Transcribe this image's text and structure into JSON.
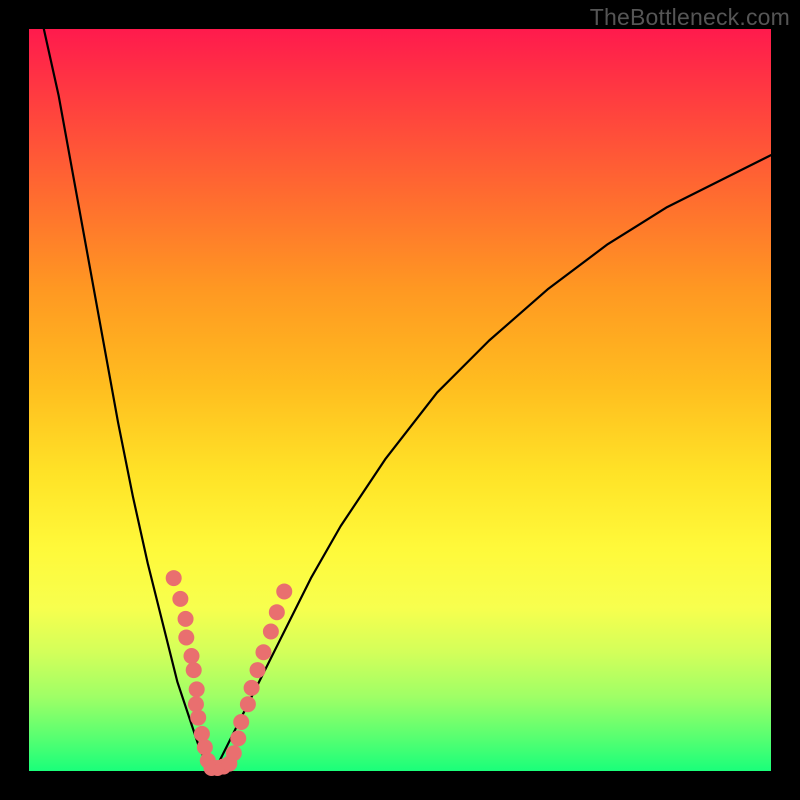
{
  "watermark": "TheBottleneck.com",
  "chart_data": {
    "type": "line",
    "title": "",
    "xlabel": "",
    "ylabel": "",
    "xlim": [
      0,
      100
    ],
    "ylim": [
      0,
      100
    ],
    "grid": false,
    "legend": false,
    "series": [
      {
        "name": "left-curve",
        "x": [
          2,
          4,
          6,
          8,
          10,
          12,
          14,
          16,
          18,
          20,
          22,
          23,
          24,
          25
        ],
        "y": [
          100,
          91,
          80,
          69,
          58,
          47,
          37,
          28,
          20,
          12,
          6,
          3,
          1,
          0
        ]
      },
      {
        "name": "right-curve",
        "x": [
          25,
          27,
          30,
          34,
          38,
          42,
          48,
          55,
          62,
          70,
          78,
          86,
          94,
          100
        ],
        "y": [
          0,
          4,
          10,
          18,
          26,
          33,
          42,
          51,
          58,
          65,
          71,
          76,
          80,
          83
        ]
      },
      {
        "name": "salmon-dots-left",
        "x": [
          19.5,
          20.4,
          21.1,
          21.2,
          21.9,
          22.2,
          22.6,
          22.5,
          22.8,
          23.3,
          23.7,
          24.1
        ],
        "y": [
          26.0,
          23.2,
          20.5,
          18.0,
          15.5,
          13.6,
          11.0,
          9.0,
          7.2,
          5.0,
          3.2,
          1.4
        ]
      },
      {
        "name": "salmon-dots-bottom",
        "x": [
          24.6,
          25.4,
          26.2,
          27.0
        ],
        "y": [
          0.4,
          0.4,
          0.6,
          1.0
        ]
      },
      {
        "name": "salmon-dots-right",
        "x": [
          27.6,
          28.2,
          28.6,
          29.5,
          30.0,
          30.8,
          31.6,
          32.6,
          33.4,
          34.4
        ],
        "y": [
          2.4,
          4.4,
          6.6,
          9.0,
          11.2,
          13.6,
          16.0,
          18.8,
          21.4,
          24.2
        ]
      }
    ],
    "colors": {
      "curve": "#000000",
      "dots": "#e96f6f"
    },
    "dot_radius_px": 8
  }
}
